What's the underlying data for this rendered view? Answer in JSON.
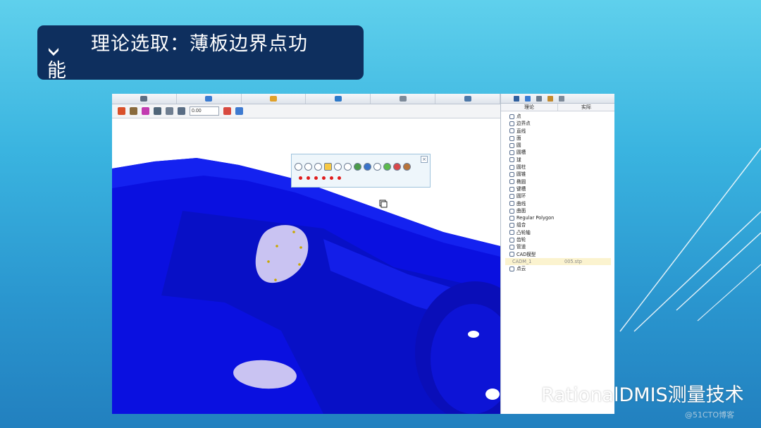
{
  "slide": {
    "title_line1": "理论选取：薄板边界点功",
    "title_line2": "能",
    "accent_color": "#0e2f5e"
  },
  "toolbar": {
    "input_value": "0.00"
  },
  "float_toolbar": {
    "close_label": "×",
    "selected_point_count": 6
  },
  "right_panel": {
    "col_theory": "理论",
    "col_actual": "实际",
    "tree": [
      {
        "label": "点"
      },
      {
        "label": "边界点"
      },
      {
        "label": "直线"
      },
      {
        "label": "面"
      },
      {
        "label": "圆"
      },
      {
        "label": "圆槽"
      },
      {
        "label": "球"
      },
      {
        "label": "圆柱"
      },
      {
        "label": "圆锥"
      },
      {
        "label": "椭圆"
      },
      {
        "label": "键槽"
      },
      {
        "label": "圆环"
      },
      {
        "label": "曲线"
      },
      {
        "label": "曲面"
      },
      {
        "label": "Regular Polygon"
      },
      {
        "label": "组合"
      },
      {
        "label": "凸轮轴"
      },
      {
        "label": "齿轮"
      },
      {
        "label": "管道"
      },
      {
        "label": "CAD模型"
      }
    ],
    "cad_child": {
      "label": "CADM_1",
      "file": "005.stp"
    },
    "last_item": "点云"
  },
  "footer": {
    "brand": "RationalDMIS测量技术",
    "site": "@51CTO博客"
  },
  "colors": {
    "model_blue": "#0a10e0",
    "cutout": "#c9c3f2",
    "point_red": "#e01a1a"
  }
}
